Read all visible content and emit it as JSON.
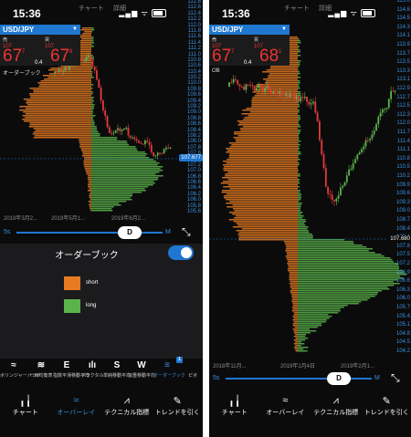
{
  "colors": {
    "accent": "#1f77d0",
    "short": "#e87b22",
    "long": "#5bb44a",
    "price_tag": "#1f77d0",
    "down": "#e33b3b"
  },
  "left": {
    "time": "15:36",
    "top_tabs": [
      "チャート",
      "詳細"
    ],
    "pair": "USD/JPY",
    "sell_label": "売",
    "buy_label": "買",
    "sell_small": "107",
    "buy_small": "107",
    "sell_big": "67",
    "sell_sup": "7",
    "buy_big": "67",
    "buy_sup": "8",
    "spread": "0.4",
    "ob_label": "オーダーブック",
    "price_ticks": [
      "112.8",
      "112.6",
      "112.4",
      "112.2",
      "112.0",
      "111.8",
      "111.6",
      "111.4",
      "111.2",
      "111.0",
      "110.8",
      "110.6",
      "110.4",
      "110.2",
      "110.0",
      "109.8",
      "109.6",
      "109.4",
      "109.2",
      "109.0",
      "108.8",
      "108.6",
      "108.4",
      "108.2",
      "108.0",
      "107.8",
      "107.6",
      "107.4",
      "107.2",
      "107.0",
      "106.8",
      "106.6",
      "106.4",
      "106.2",
      "106.0",
      "105.8",
      "105.6"
    ],
    "current_price": "107.677",
    "dates": [
      "2019年3月2...",
      "2019年5月1...",
      "2019年6月2..."
    ],
    "timeframe_left": "5s",
    "timeframe_knob": "D",
    "timeframe_right": "M",
    "orderbook_title": "オーダーブック",
    "legend": [
      {
        "label": "short",
        "icon": "orange-swatch"
      },
      {
        "label": "long",
        "icon": "green-swatch"
      }
    ],
    "indicators": [
      {
        "glyph": "≈",
        "label": "ボリンジャーバンド",
        "icon": "bollinger-icon"
      },
      {
        "glyph": "≋",
        "label": "一目均衡表",
        "icon": "ichimoku-icon"
      },
      {
        "glyph": "E",
        "label": "指数平滑移動平均",
        "icon": "ema-icon"
      },
      {
        "glyph": "ılı",
        "label": "フラクタル",
        "icon": "fractal-icon"
      },
      {
        "glyph": "S",
        "label": "単純移動平均",
        "icon": "sma-icon"
      },
      {
        "glyph": "W",
        "label": "加重移動平均",
        "icon": "wma-icon"
      },
      {
        "glyph": "≡",
        "label": "オーダーブック",
        "icon": "orderbook-icon",
        "badge": "1"
      },
      {
        "glyph": "",
        "label": "ピボ",
        "icon": "pivot-icon"
      }
    ],
    "nav": [
      {
        "label": "チャート",
        "icon": "candle-icon",
        "glyph": "╻╽",
        "active": false
      },
      {
        "label": "オーバーレイ",
        "icon": "overlay-icon",
        "glyph": "≈",
        "active": true
      },
      {
        "label": "テクニカル指標",
        "icon": "technical-icon",
        "glyph": "⩘",
        "active": false
      },
      {
        "label": "トレンドを引く",
        "icon": "pencil-icon",
        "glyph": "✎",
        "active": false
      }
    ]
  },
  "right": {
    "time": "15:36",
    "top_tabs": [
      "チャート",
      "詳細"
    ],
    "pair": "USD/JPY",
    "sell_label": "売",
    "buy_label": "買",
    "sell_small": "107",
    "buy_small": "107",
    "sell_big": "67",
    "sell_sup": "7",
    "buy_big": "68",
    "buy_sup": "1",
    "spread": "0.4",
    "ob_label": "OB",
    "price_ticks": [
      "115.0",
      "114.8",
      "114.5",
      "114.3",
      "114.1",
      "113.9",
      "113.7",
      "113.5",
      "113.3",
      "113.1",
      "112.9",
      "112.7",
      "112.5",
      "112.3",
      "112.0",
      "111.7",
      "111.4",
      "111.1",
      "110.8",
      "110.5",
      "110.2",
      "109.9",
      "109.6",
      "109.3",
      "109.0",
      "108.7",
      "108.4",
      "108.1",
      "107.8",
      "107.5",
      "107.2",
      "106.9",
      "106.6",
      "106.3",
      "106.0",
      "105.7",
      "105.4",
      "105.1",
      "104.8",
      "104.5",
      "104.2"
    ],
    "current_price": "107.680",
    "dates": [
      "2018年11月...",
      "2019年1月4日",
      "2019年2月1..."
    ],
    "timeframe_left": "5s",
    "timeframe_knob": "D",
    "timeframe_right": "M",
    "nav": [
      {
        "label": "チャート",
        "icon": "candle-icon",
        "glyph": "╻╽",
        "active": false
      },
      {
        "label": "オーバーレイ",
        "icon": "overlay-icon",
        "glyph": "≈",
        "active": false
      },
      {
        "label": "テクニカル指標",
        "icon": "technical-icon",
        "glyph": "⩘",
        "active": false
      },
      {
        "label": "トレンドを引く",
        "icon": "pencil-icon",
        "glyph": "✎",
        "active": false
      }
    ]
  }
}
